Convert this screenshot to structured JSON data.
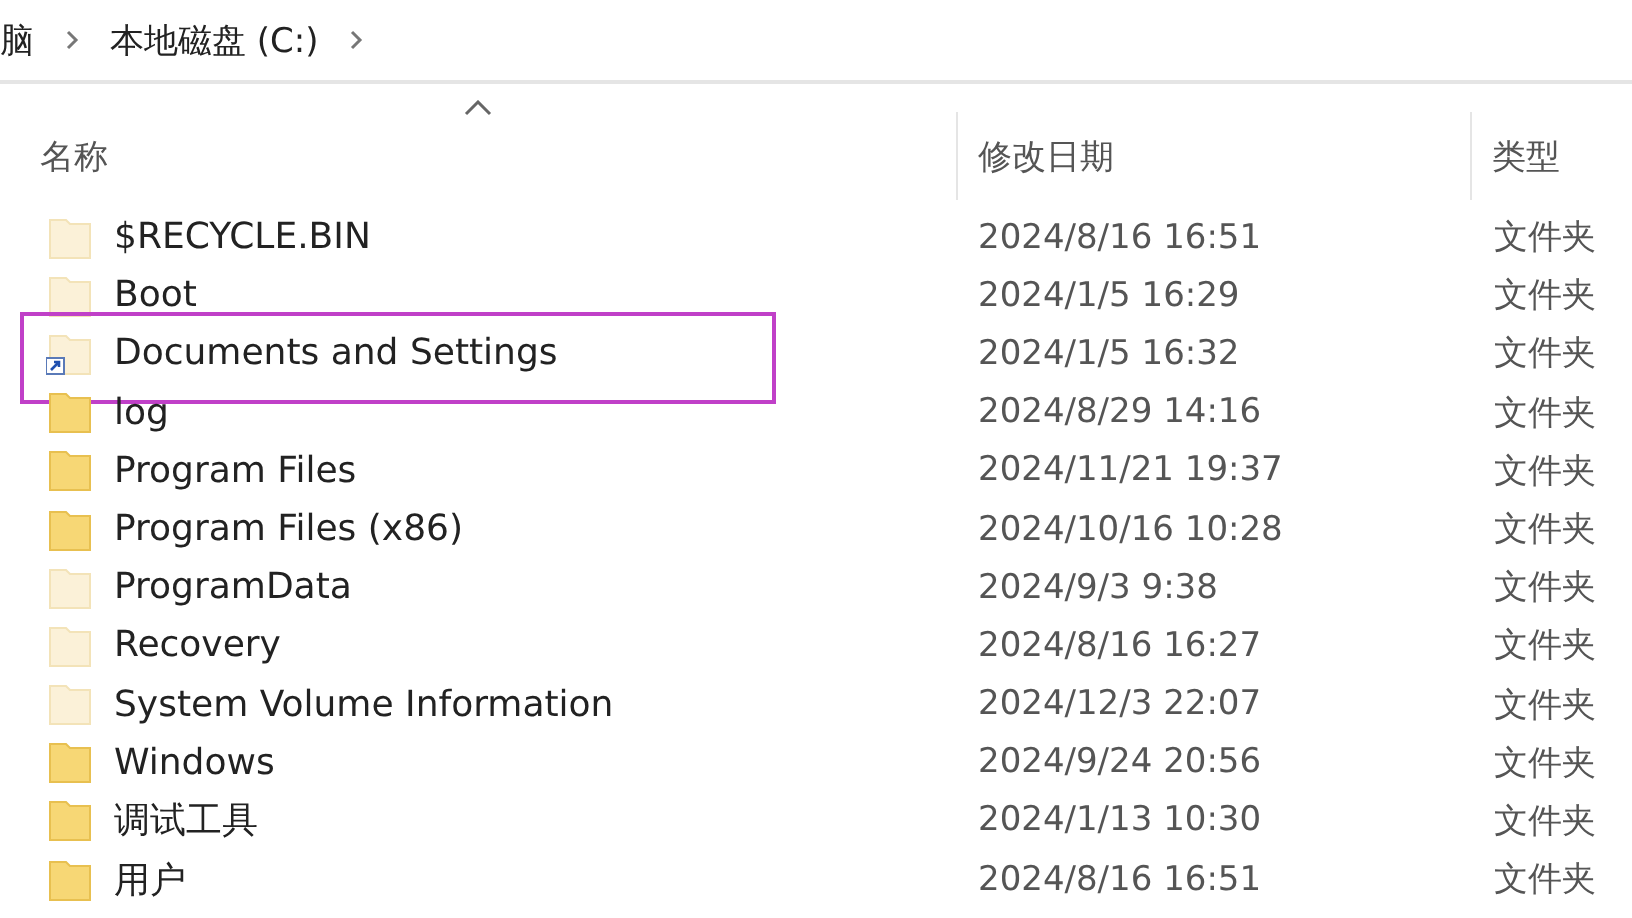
{
  "breadcrumb": [
    "脑",
    "本地磁盘 (C:)"
  ],
  "columns": [
    {
      "label": "名称",
      "sorted": true
    },
    {
      "label": "修改日期",
      "sorted": false
    },
    {
      "label": "类型",
      "sorted": false
    }
  ],
  "rows": [
    {
      "name": "$RECYCLE.BIN",
      "date": "2024/8/16 16:51",
      "type": "文件夹",
      "hidden": true,
      "shortcut": false,
      "highlighted": false
    },
    {
      "name": "Boot",
      "date": "2024/1/5 16:29",
      "type": "文件夹",
      "hidden": true,
      "shortcut": false,
      "highlighted": false
    },
    {
      "name": "Documents and Settings",
      "date": "2024/1/5 16:32",
      "type": "文件夹",
      "hidden": true,
      "shortcut": true,
      "highlighted": true
    },
    {
      "name": "log",
      "date": "2024/8/29 14:16",
      "type": "文件夹",
      "hidden": false,
      "shortcut": false,
      "highlighted": false
    },
    {
      "name": "Program Files",
      "date": "2024/11/21 19:37",
      "type": "文件夹",
      "hidden": false,
      "shortcut": false,
      "highlighted": false
    },
    {
      "name": "Program Files (x86)",
      "date": "2024/10/16 10:28",
      "type": "文件夹",
      "hidden": false,
      "shortcut": false,
      "highlighted": false
    },
    {
      "name": "ProgramData",
      "date": "2024/9/3 9:38",
      "type": "文件夹",
      "hidden": true,
      "shortcut": false,
      "highlighted": false
    },
    {
      "name": "Recovery",
      "date": "2024/8/16 16:27",
      "type": "文件夹",
      "hidden": true,
      "shortcut": false,
      "highlighted": false
    },
    {
      "name": "System Volume Information",
      "date": "2024/12/3 22:07",
      "type": "文件夹",
      "hidden": true,
      "shortcut": false,
      "highlighted": false
    },
    {
      "name": "Windows",
      "date": "2024/9/24 20:56",
      "type": "文件夹",
      "hidden": false,
      "shortcut": false,
      "highlighted": false
    },
    {
      "name": "调试工具",
      "date": "2024/1/13 10:30",
      "type": "文件夹",
      "hidden": false,
      "shortcut": false,
      "highlighted": false
    },
    {
      "name": "用户",
      "date": "2024/8/16 16:51",
      "type": "文件夹",
      "hidden": false,
      "shortcut": false,
      "highlighted": false
    }
  ]
}
